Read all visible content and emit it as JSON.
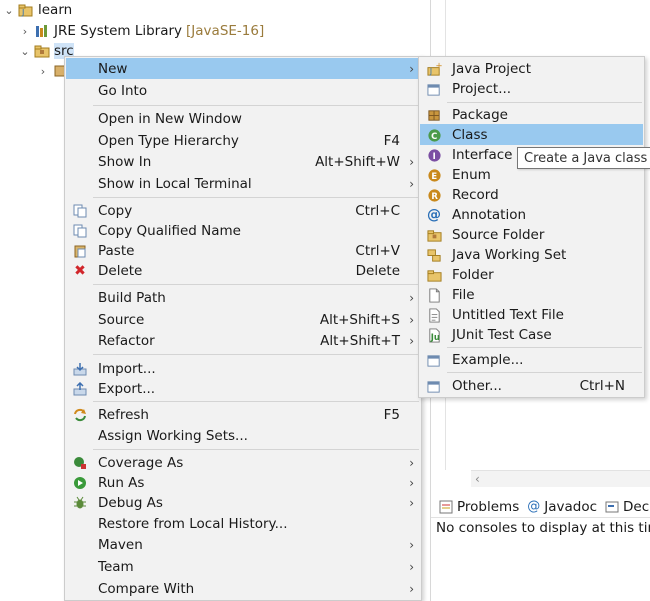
{
  "tree": {
    "project": "learn",
    "jre_label": "JRE System Library",
    "jre_deco": "[JavaSE-16]",
    "src_label": "src"
  },
  "context_menu": {
    "items": [
      {
        "label": "New",
        "accel": "",
        "submenu": true
      },
      {
        "label": "Go Into",
        "accel": "",
        "submenu": false
      },
      {
        "label": "Open in New Window",
        "accel": "",
        "submenu": false
      },
      {
        "label": "Open Type Hierarchy",
        "accel": "F4",
        "submenu": false
      },
      {
        "label": "Show In",
        "accel": "Alt+Shift+W",
        "submenu": true
      },
      {
        "label": "Show in Local Terminal",
        "accel": "",
        "submenu": true
      },
      {
        "label": "Copy",
        "accel": "Ctrl+C",
        "submenu": false
      },
      {
        "label": "Copy Qualified Name",
        "accel": "",
        "submenu": false
      },
      {
        "label": "Paste",
        "accel": "Ctrl+V",
        "submenu": false
      },
      {
        "label": "Delete",
        "accel": "Delete",
        "submenu": false
      },
      {
        "label": "Build Path",
        "accel": "",
        "submenu": true
      },
      {
        "label": "Source",
        "accel": "Alt+Shift+S",
        "submenu": true
      },
      {
        "label": "Refactor",
        "accel": "Alt+Shift+T",
        "submenu": true
      },
      {
        "label": "Import...",
        "accel": "",
        "submenu": false
      },
      {
        "label": "Export...",
        "accel": "",
        "submenu": false
      },
      {
        "label": "Refresh",
        "accel": "F5",
        "submenu": false
      },
      {
        "label": "Assign Working Sets...",
        "accel": "",
        "submenu": false
      },
      {
        "label": "Coverage As",
        "accel": "",
        "submenu": true
      },
      {
        "label": "Run As",
        "accel": "",
        "submenu": true
      },
      {
        "label": "Debug As",
        "accel": "",
        "submenu": true
      },
      {
        "label": "Restore from Local History...",
        "accel": "",
        "submenu": false
      },
      {
        "label": "Maven",
        "accel": "",
        "submenu": true
      },
      {
        "label": "Team",
        "accel": "",
        "submenu": true
      },
      {
        "label": "Compare With",
        "accel": "",
        "submenu": true
      }
    ]
  },
  "new_submenu": {
    "items": [
      {
        "label": "Java Project",
        "accel": ""
      },
      {
        "label": "Project...",
        "accel": ""
      },
      {
        "label": "Package",
        "accel": ""
      },
      {
        "label": "Class",
        "accel": ""
      },
      {
        "label": "Interface",
        "accel": ""
      },
      {
        "label": "Enum",
        "accel": ""
      },
      {
        "label": "Record",
        "accel": ""
      },
      {
        "label": "Annotation",
        "accel": ""
      },
      {
        "label": "Source Folder",
        "accel": ""
      },
      {
        "label": "Java Working Set",
        "accel": ""
      },
      {
        "label": "Folder",
        "accel": ""
      },
      {
        "label": "File",
        "accel": ""
      },
      {
        "label": "Untitled Text File",
        "accel": ""
      },
      {
        "label": "JUnit Test Case",
        "accel": ""
      },
      {
        "label": "Example...",
        "accel": ""
      },
      {
        "label": "Other...",
        "accel": "Ctrl+N"
      }
    ]
  },
  "tooltip": "Create a Java class",
  "console": {
    "tabs": [
      "Problems",
      "Javadoc",
      "Dec"
    ],
    "message": "No consoles to display at this tim"
  },
  "colors": {
    "menu_bg": "#f2f2f2",
    "selection": "#99c9ef",
    "accent": "#2a6fb7"
  }
}
